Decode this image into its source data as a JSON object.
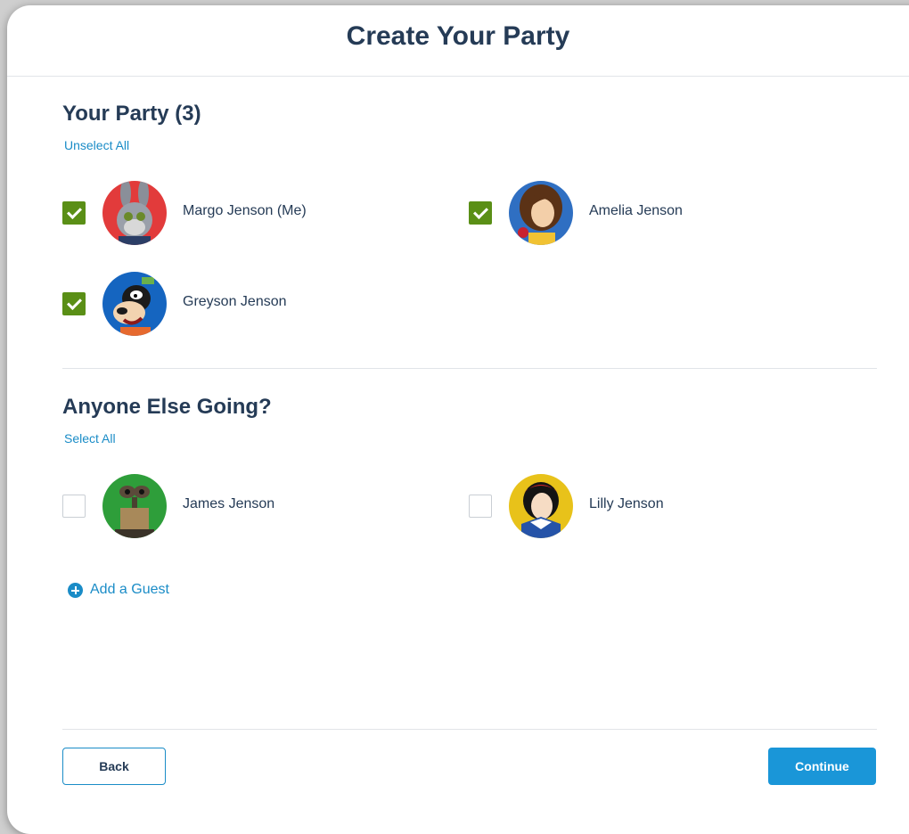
{
  "header": {
    "title": "Create Your Party"
  },
  "your_party": {
    "title": "Your Party (3)",
    "toggle_link": "Unselect All",
    "guests": [
      {
        "name": "Margo Jenson (Me)",
        "checked": true,
        "avatar": "rabbit-character-avatar",
        "avatar_color": "#e23b3b"
      },
      {
        "name": "Amelia Jenson",
        "checked": true,
        "avatar": "princess-belle-avatar",
        "avatar_color": "#2f6fc2"
      },
      {
        "name": "Greyson Jenson",
        "checked": true,
        "avatar": "goofy-avatar",
        "avatar_color": "#1565c0"
      }
    ]
  },
  "anyone_else": {
    "title": "Anyone Else Going?",
    "toggle_link": "Select All",
    "guests": [
      {
        "name": "James Jenson",
        "checked": false,
        "avatar": "robot-character-avatar",
        "avatar_color": "#2e9e3a"
      },
      {
        "name": "Lilly Jenson",
        "checked": false,
        "avatar": "snow-white-avatar",
        "avatar_color": "#e8c21a"
      }
    ]
  },
  "add_guest": {
    "label": "Add a Guest",
    "icon": "plus-circle-icon"
  },
  "footer": {
    "back_label": "Back",
    "continue_label": "Continue"
  },
  "colors": {
    "heading": "#253b56",
    "link": "#1a8cc7",
    "checkbox_checked": "#5a8f16",
    "primary_button": "#1a96d8"
  }
}
